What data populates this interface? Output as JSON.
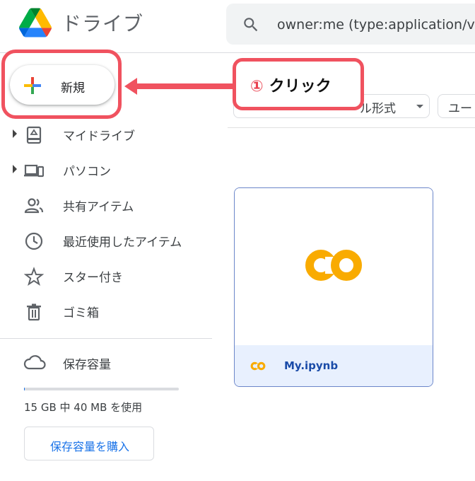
{
  "header": {
    "app_name": "ドライブ",
    "search_query": "owner:me (type:application/vnd",
    "icons": {
      "logo": "google-drive-logo",
      "search": "search-icon"
    }
  },
  "new_button": {
    "label": "新規",
    "icon": "plus-multicolor-icon"
  },
  "callout": {
    "number": "①",
    "text": "クリック",
    "accent_color": "#f0525f"
  },
  "filters": {
    "type_chip": {
      "label": "ル形式",
      "icon": "caret-down-icon"
    },
    "user_chip": {
      "label": "ユー"
    }
  },
  "sidebar": {
    "items": [
      {
        "label": "マイドライブ",
        "icon": "my-drive-icon",
        "expandable": true
      },
      {
        "label": "パソコン",
        "icon": "computers-icon",
        "expandable": true
      },
      {
        "label": "共有アイテム",
        "icon": "shared-people-icon",
        "expandable": false
      },
      {
        "label": "最近使用したアイテム",
        "icon": "clock-icon",
        "expandable": false
      },
      {
        "label": "スター付き",
        "icon": "star-icon",
        "expandable": false
      },
      {
        "label": "ゴミ箱",
        "icon": "trash-icon",
        "expandable": false
      }
    ]
  },
  "storage": {
    "label": "保存容量",
    "icon": "cloud-icon",
    "usage_text": "15 GB 中 40 MB を使用",
    "used_fraction": 0.0027,
    "buy_label": "保存容量を購入"
  },
  "files": [
    {
      "name": "My.ipynb",
      "icon": "colab-icon"
    }
  ],
  "colors": {
    "accent_blue": "#1a73e8",
    "highlight_red": "#f0525f",
    "colab_yellow": "#f9ab00"
  }
}
